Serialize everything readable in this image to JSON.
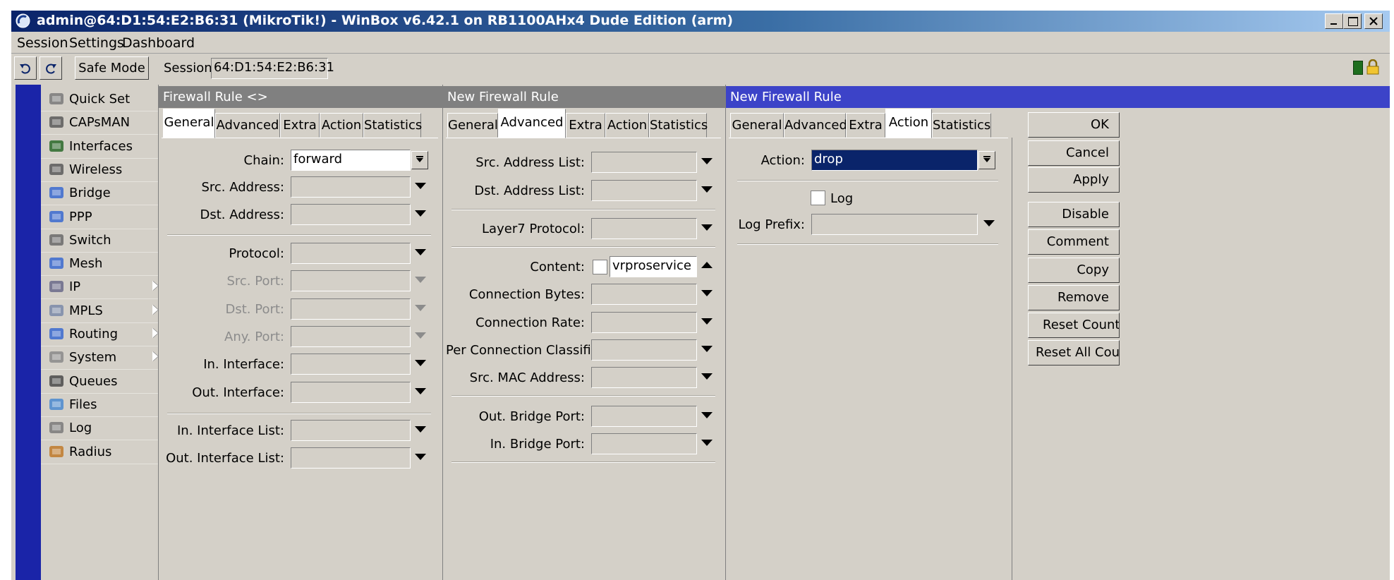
{
  "window": {
    "title": "admin@64:D1:54:E2:B6:31 (MikroTik!) - WinBox v6.42.1 on RB1100AHx4 Dude Edition (arm)"
  },
  "menu": [
    "Session",
    "Settings",
    "Dashboard"
  ],
  "toolbar": {
    "safe_mode": "Safe Mode",
    "session_label": "Session:",
    "session_value": "64:D1:54:E2:B6:31"
  },
  "sidebar": {
    "items": [
      {
        "label": "Quick Set",
        "icon": "quick-set-icon",
        "arrow": false
      },
      {
        "label": "CAPsMAN",
        "icon": "capsman-icon",
        "arrow": false
      },
      {
        "label": "Interfaces",
        "icon": "interfaces-icon",
        "arrow": false
      },
      {
        "label": "Wireless",
        "icon": "wireless-icon",
        "arrow": false
      },
      {
        "label": "Bridge",
        "icon": "bridge-icon",
        "arrow": false
      },
      {
        "label": "PPP",
        "icon": "ppp-icon",
        "arrow": false
      },
      {
        "label": "Switch",
        "icon": "switch-icon",
        "arrow": false
      },
      {
        "label": "Mesh",
        "icon": "mesh-icon",
        "arrow": false
      },
      {
        "label": "IP",
        "icon": "ip-icon",
        "arrow": true
      },
      {
        "label": "MPLS",
        "icon": "mpls-icon",
        "arrow": true
      },
      {
        "label": "Routing",
        "icon": "routing-icon",
        "arrow": true
      },
      {
        "label": "System",
        "icon": "system-icon",
        "arrow": true
      },
      {
        "label": "Queues",
        "icon": "queues-icon",
        "arrow": false
      },
      {
        "label": "Files",
        "icon": "files-icon",
        "arrow": false
      },
      {
        "label": "Log",
        "icon": "log-icon",
        "arrow": false
      },
      {
        "label": "Radius",
        "icon": "radius-icon",
        "arrow": false
      }
    ]
  },
  "panel1": {
    "title": "Firewall Rule <>",
    "tabs": [
      "General",
      "Advanced",
      "Extra",
      "Action",
      "Statistics"
    ],
    "fields": {
      "chain_label": "Chain:",
      "chain_value": "forward",
      "src_address": "Src. Address:",
      "dst_address": "Dst. Address:",
      "protocol": "Protocol:",
      "src_port": "Src. Port:",
      "dst_port": "Dst. Port:",
      "any_port": "Any. Port:",
      "in_interface": "In. Interface:",
      "out_interface": "Out. Interface:",
      "in_interface_list": "In. Interface List:",
      "out_interface_list": "Out. Interface List:"
    }
  },
  "panel2": {
    "title": "New Firewall Rule",
    "tabs": [
      "General",
      "Advanced",
      "Extra",
      "Action",
      "Statistics"
    ],
    "fields": {
      "src_address_list": "Src. Address List:",
      "dst_address_list": "Dst. Address List:",
      "layer7_protocol": "Layer7 Protocol:",
      "content_label": "Content:",
      "content_value": "vrproservice",
      "connection_bytes": "Connection Bytes:",
      "connection_rate": "Connection Rate:",
      "per_connection_classifier": "Per Connection Classifier:",
      "src_mac_address": "Src. MAC Address:",
      "out_bridge_port": "Out. Bridge Port:",
      "in_bridge_port": "In. Bridge Port:"
    }
  },
  "panel3": {
    "title": "New Firewall Rule",
    "tabs": [
      "General",
      "Advanced",
      "Extra",
      "Action",
      "Statistics"
    ],
    "fields": {
      "action_label": "Action:",
      "action_value": "drop",
      "log_label": "Log",
      "log_prefix_label": "Log Prefix:"
    },
    "buttons": [
      "OK",
      "Cancel",
      "Apply",
      "Disable",
      "Comment",
      "Copy",
      "Remove",
      "Reset Counters",
      "Reset All Counters"
    ]
  },
  "colors": {
    "active_title": "#3c43c8",
    "inactive_title": "#808080",
    "titlebar_start": "#0a246a"
  }
}
